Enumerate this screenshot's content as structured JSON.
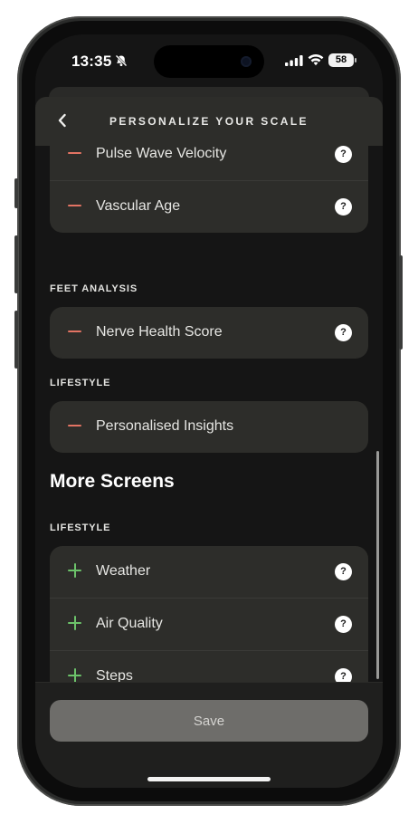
{
  "status_bar": {
    "time": "13:35",
    "icons": [
      "bell-slash-icon",
      "cellular-signal-icon",
      "wifi-icon"
    ],
    "battery": "58"
  },
  "header": {
    "back_icon": "chevron-left-icon",
    "title": "PERSONALIZE YOUR SCALE"
  },
  "top_group": {
    "rows": [
      {
        "label": "Pulse Wave Velocity",
        "action": "remove"
      },
      {
        "label": "Vascular Age",
        "action": "remove"
      }
    ]
  },
  "feet_analysis": {
    "title": "FEET ANALYSIS",
    "rows": [
      {
        "label": "Nerve Health Score",
        "action": "remove"
      }
    ]
  },
  "lifestyle_active": {
    "title": "LIFESTYLE",
    "rows": [
      {
        "label": "Personalised Insights",
        "action": "remove"
      }
    ]
  },
  "more_screens": {
    "heading": "More Screens",
    "section_title": "LIFESTYLE",
    "rows": [
      {
        "label": "Weather",
        "action": "add"
      },
      {
        "label": "Air Quality",
        "action": "add"
      },
      {
        "label": "Steps",
        "action": "add"
      }
    ]
  },
  "help_glyph": "?",
  "footer": {
    "save_label": "Save"
  },
  "colors": {
    "remove": "#e27363",
    "add": "#6cc26a",
    "card": "#2d2d2a",
    "background": "#151515"
  }
}
